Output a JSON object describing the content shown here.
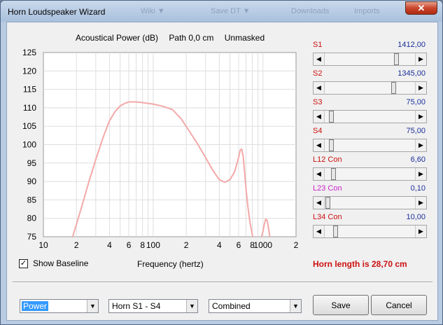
{
  "window": {
    "title": "Horn Loudspeaker Wizard",
    "close_glyph": "✕",
    "ghost_titles": [
      "Wiki ▼",
      "Save DT ▼",
      "Downloads",
      "Imports"
    ]
  },
  "chart_header": {
    "measure": "Acoustical Power (dB)",
    "path": "Path 0,0 cm",
    "mask": "Unmasked"
  },
  "chart_data": {
    "type": "line",
    "title": "Acoustical Power (dB)",
    "xlabel": "Frequency (hertz)",
    "ylabel": "",
    "x_scale": "log",
    "xlim": [
      10,
      2000
    ],
    "ylim": [
      75,
      125
    ],
    "grid": true,
    "line_color": "#f4a8a8",
    "y_ticks": [
      75,
      80,
      85,
      90,
      95,
      100,
      105,
      110,
      115,
      120,
      125
    ],
    "x_ticks": [
      {
        "value": 10,
        "label": "10"
      },
      {
        "value": 20,
        "label": "2"
      },
      {
        "value": 40,
        "label": "4"
      },
      {
        "value": 60,
        "label": "6"
      },
      {
        "value": 80,
        "label": "8"
      },
      {
        "value": 100,
        "label": "100"
      },
      {
        "value": 200,
        "label": "2"
      },
      {
        "value": 400,
        "label": "4"
      },
      {
        "value": 600,
        "label": "6"
      },
      {
        "value": 800,
        "label": "8"
      },
      {
        "value": 1000,
        "label": "1000"
      },
      {
        "value": 2000,
        "label": "2"
      }
    ],
    "series": [
      {
        "x": [
          18.5,
          22,
          26,
          30,
          35,
          40,
          45,
          50,
          55,
          60,
          70,
          80,
          100,
          120,
          150,
          180,
          210,
          250,
          300,
          350,
          400,
          450,
          500,
          550,
          600,
          620,
          640,
          660,
          680,
          700,
          730,
          760,
          800,
          850,
          900,
          950,
          1000,
          1030,
          1060,
          1090,
          1120,
          1160,
          1200
        ],
        "y": [
          75,
          82.5,
          90,
          96,
          102,
          106.5,
          109,
          110.5,
          111.2,
          111.6,
          111.6,
          111.4,
          111,
          110.5,
          109.5,
          107,
          104,
          100.5,
          96.5,
          93,
          90.5,
          89.8,
          90.5,
          92.5,
          96.5,
          98.5,
          98.8,
          96.8,
          92.5,
          88,
          83,
          79,
          75.5,
          73,
          72.5,
          74,
          76.5,
          78.5,
          79.8,
          79.5,
          77.5,
          74.5,
          72
        ]
      }
    ]
  },
  "sliders": [
    {
      "name": "S1",
      "value": "1412,00",
      "name_color": "#cc1010",
      "position": 0.82
    },
    {
      "name": "S2",
      "value": "1345,00",
      "name_color": "#cc1010",
      "position": 0.78
    },
    {
      "name": "S3",
      "value": "75,00",
      "name_color": "#cc1010",
      "position": 0.04
    },
    {
      "name": "S4",
      "value": "75,00",
      "name_color": "#cc1010",
      "position": 0.04
    },
    {
      "name": "L12  Con",
      "value": "6,60",
      "name_color": "#cc1010",
      "position": 0.07
    },
    {
      "name": "L23  Con",
      "value": "0,10",
      "name_color": "#cc22cc",
      "position": 0.0
    },
    {
      "name": "L34  Con",
      "value": "10,00",
      "name_color": "#cc1010",
      "position": 0.09
    }
  ],
  "controls": {
    "show_baseline_label": "Show Baseline",
    "show_baseline_checked": true,
    "check_glyph": "✓",
    "frequency_label": "Frequency (hertz)",
    "horn_length": "Horn length is 28,70 cm",
    "dropdown_glyph": "▼",
    "arrow_left_glyph": "◀",
    "arrow_right_glyph": "▶",
    "combo_type": "Power",
    "combo_horn": "Horn S1 - S4",
    "combo_mode": "Combined",
    "save_label": "Save",
    "cancel_label": "Cancel"
  }
}
